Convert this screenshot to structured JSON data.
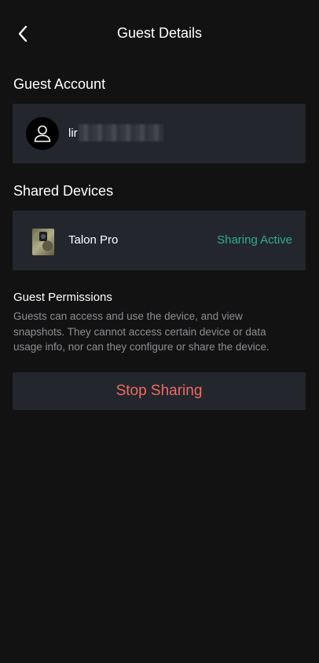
{
  "header": {
    "title": "Guest Details",
    "back_icon": "chevron-left-icon"
  },
  "guest_account": {
    "section_title": "Guest Account",
    "avatar_icon": "user-icon",
    "name_visible": "lir"
  },
  "shared_devices": {
    "section_title": "Shared Devices",
    "items": [
      {
        "name": "Talon Pro",
        "status": "Sharing Active",
        "status_color": "#2cae8d",
        "thumbnail": "trail-camera-icon"
      }
    ]
  },
  "permissions": {
    "title": "Guest Permissions",
    "description": "Guests can access and use the device, and view snapshots. They cannot access certain device or data usage info, nor can they configure or share the device."
  },
  "actions": {
    "stop_sharing_label": "Stop Sharing",
    "stop_sharing_color": "#f06b60"
  }
}
